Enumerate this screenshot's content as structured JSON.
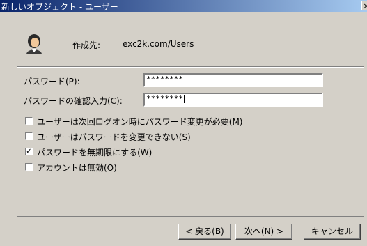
{
  "window": {
    "title": "新しいオブジェクト - ユーザー",
    "close_glyph": "×"
  },
  "header": {
    "create_label": "作成先:",
    "create_value": "exc2k.com/Users",
    "icon": "user-icon"
  },
  "fields": {
    "password_label": "パスワード(P):",
    "password_value": "********",
    "confirm_label": "パスワードの確認入力(C):",
    "confirm_value": "********"
  },
  "options": [
    {
      "label": "ユーザーは次回ログオン時にパスワード変更が必要(M)",
      "checked": false
    },
    {
      "label": "ユーザーはパスワードを変更できない(S)",
      "checked": false
    },
    {
      "label": "パスワードを無期限にする(W)",
      "checked": true
    },
    {
      "label": "アカウントは無効(O)",
      "checked": false
    }
  ],
  "buttons": {
    "back": "< 戻る(B)",
    "next": "次へ(N) >",
    "cancel": "キャンセル"
  },
  "colors": {
    "title_start": "#0a246a",
    "title_end": "#a6caf0",
    "face": "#d4d0c8"
  }
}
